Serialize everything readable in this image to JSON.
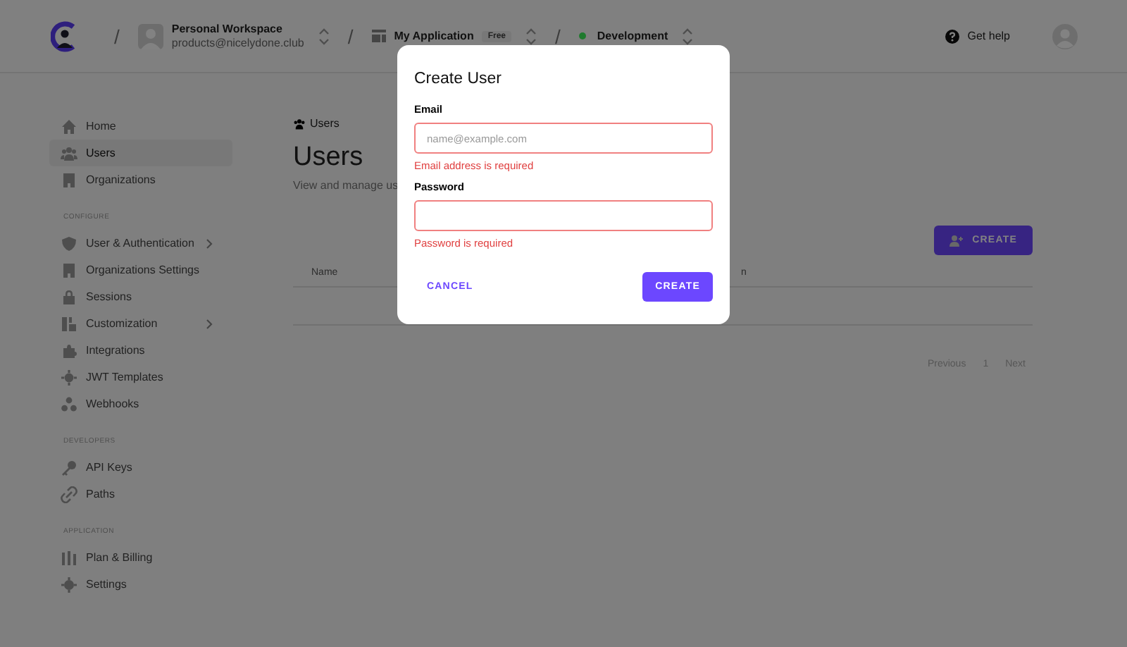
{
  "topbar": {
    "workspace": {
      "name": "Personal Workspace",
      "email": "products@nicelydone.club"
    },
    "application": {
      "name": "My Application",
      "badge": "Free"
    },
    "environment": {
      "name": "Development",
      "color": "#1f7a2e"
    },
    "separators": [
      "/",
      "/",
      "/"
    ],
    "help": "Get help"
  },
  "sidebar": {
    "sections": [
      {
        "items": [
          {
            "label": "Home",
            "selected": false,
            "has_submenu": false
          },
          {
            "label": "Users",
            "selected": true,
            "has_submenu": false
          },
          {
            "label": "Organizations",
            "selected": false,
            "has_submenu": false
          }
        ]
      },
      {
        "heading": "CONFIGURE",
        "items": [
          {
            "label": "User & Authentication",
            "selected": false,
            "has_submenu": true
          },
          {
            "label": "Organizations Settings",
            "selected": false,
            "has_submenu": false
          },
          {
            "label": "Sessions",
            "selected": false,
            "has_submenu": false
          },
          {
            "label": "Customization",
            "selected": false,
            "has_submenu": true
          },
          {
            "label": "Integrations",
            "selected": false,
            "has_submenu": false
          },
          {
            "label": "JWT Templates",
            "selected": false,
            "has_submenu": false
          },
          {
            "label": "Webhooks",
            "selected": false,
            "has_submenu": false
          }
        ]
      },
      {
        "heading": "DEVELOPERS",
        "items": [
          {
            "label": "API Keys",
            "selected": false,
            "has_submenu": false
          },
          {
            "label": "Paths",
            "selected": false,
            "has_submenu": false
          }
        ]
      },
      {
        "heading": "APPLICATION",
        "items": [
          {
            "label": "Plan & Billing",
            "selected": false,
            "has_submenu": false
          },
          {
            "label": "Settings",
            "selected": false,
            "has_submenu": false
          }
        ]
      }
    ]
  },
  "main": {
    "breadcrumb": "Users",
    "title": "Users",
    "subtitle": "View and manage us",
    "create_button": "CREATE",
    "table": {
      "columns": [
        "Name",
        "n"
      ]
    },
    "pagination": {
      "previous": "Previous",
      "page": "1",
      "next": "Next"
    }
  },
  "dialog": {
    "title": "Create User",
    "fields": [
      {
        "label": "Email",
        "placeholder": "name@example.com",
        "error": "Email address is required"
      },
      {
        "label": "Password",
        "error": "Password is required"
      }
    ],
    "cancel": "CANCEL",
    "submit": "CREATE"
  }
}
